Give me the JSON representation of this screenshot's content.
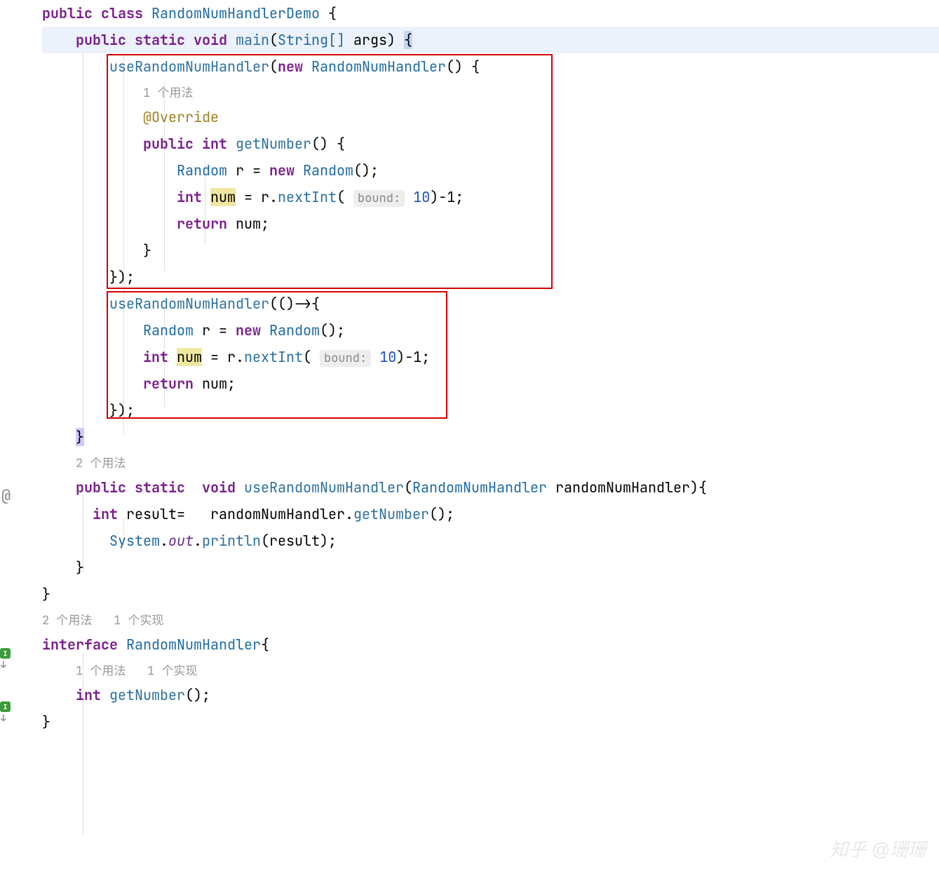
{
  "code": {
    "kw_public": "public",
    "kw_class": "class",
    "kw_static": "static",
    "kw_void": "void",
    "kw_new": "new",
    "kw_int": "int",
    "kw_return": "return",
    "kw_interface": "interface",
    "class_name": "RandomNumHandlerDemo",
    "method_main": "main",
    "type_string_arr": "String[]",
    "param_args": "args",
    "call_useRandom": "useRandomNumHandler",
    "type_RandomNumHandler": "RandomNumHandler",
    "usage_1": "1 个用法",
    "usage_2": "2 个用法",
    "impl_1": "1 个实现",
    "anno_override": "@Override",
    "method_getNumber": "getNumber",
    "type_Random": "Random",
    "var_r": "r",
    "var_num": "num",
    "method_nextInt": "nextInt",
    "hint_bound": "bound:",
    "val_10": "10",
    "val_minus1": "-1",
    "lambda_arrow": "()->",
    "var_result": "result",
    "var_randomNumHandler": "randomNumHandler",
    "sys": "System",
    "out": "out",
    "println": "println",
    "interface_name": "RandomNumHandler",
    "usage_2_impl_1": "2 个用法   1 个实现",
    "usage_1_impl_1": "1 个用法   1 个实现"
  },
  "watermark": "知乎 @珊珊"
}
